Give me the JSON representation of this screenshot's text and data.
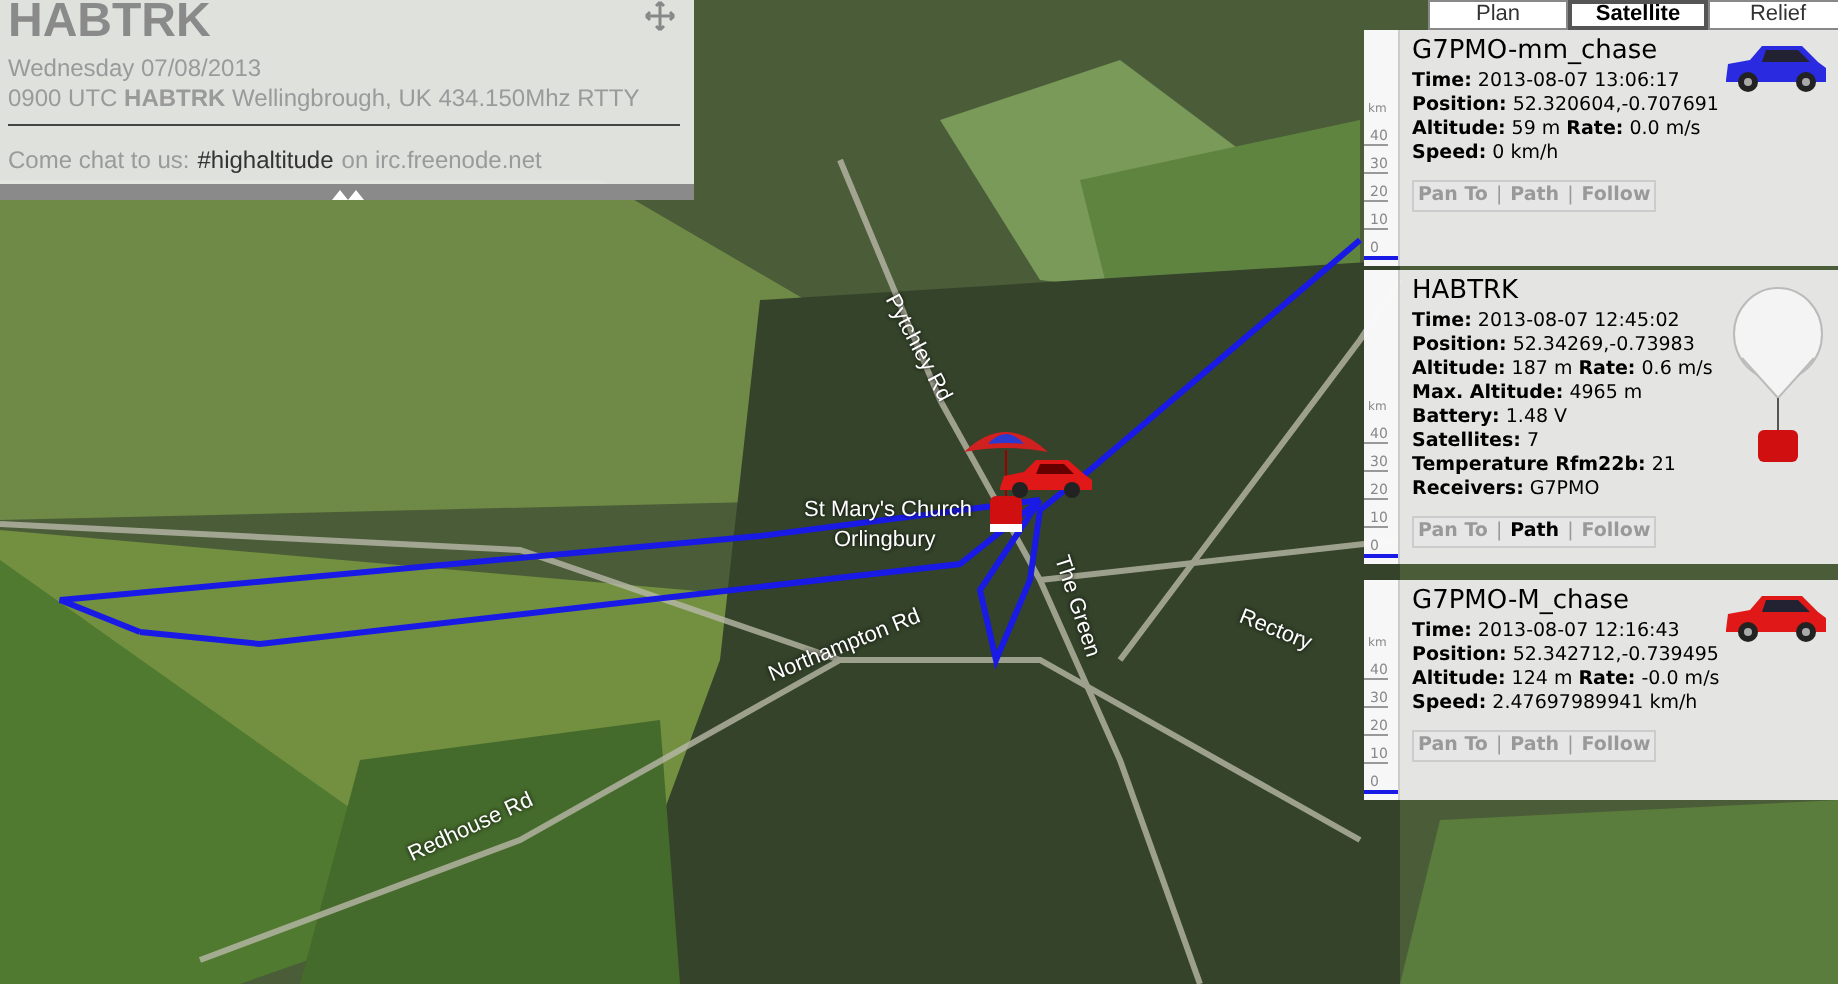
{
  "header": {
    "title": "HABTRK",
    "date": "Wednesday 07/08/2013",
    "launch": "0900 UTC **HABTRK** Wellingbrough, UK 434.150Mhz RTTY",
    "chat_prefix": "Come chat to us:",
    "chat_link": "#highaltitude",
    "chat_suffix": "on irc.freenode.net"
  },
  "map_types": [
    {
      "label": "Plan",
      "selected": false
    },
    {
      "label": "Satellite",
      "selected": true
    },
    {
      "label": "Relief",
      "selected": false
    }
  ],
  "map_labels": [
    "Pytchley Rd",
    "St Mary's Church",
    "Orlingbury",
    "The Green",
    "Northampton Rd",
    "Rectory",
    "Redhouse Rd"
  ],
  "vehicles": [
    {
      "name": "G7PMO-mm_chase",
      "kind": "car",
      "color": "#2a2ae0",
      "separator": "|",
      "lines": [
        "**Time:** 2013-08-07 13:06:17",
        "**Position:** 52.320604,-0.707691",
        "**Altitude:** 59 m **Rate:** 0.0 m/s",
        "**Speed:** 0 km/h"
      ],
      "actions": [
        {
          "label": "Pan To",
          "active": false
        },
        {
          "label": "Path",
          "active": false
        },
        {
          "label": "Follow",
          "active": false
        }
      ],
      "scale": {
        "unit": "km",
        "ticks": [
          "40",
          "30",
          "20",
          "10",
          "0"
        ],
        "level": 0
      }
    },
    {
      "name": "HABTRK",
      "kind": "balloon",
      "color": "#d01010",
      "separator": "|",
      "lines": [
        "**Time:** 2013-08-07 12:45:02",
        "**Position:** 52.34269,-0.73983",
        "**Altitude:** 187 m **Rate:** 0.6 m/s",
        "**Max. Altitude:** 4965 m",
        "**Battery:** 1.48 V",
        "**Satellites:** 7",
        "**Temperature Rfm22b:** 21",
        "**Receivers:** G7PMO"
      ],
      "actions": [
        {
          "label": "Pan To",
          "active": false
        },
        {
          "label": "Path",
          "active": true
        },
        {
          "label": "Follow",
          "active": false
        }
      ],
      "scale": {
        "unit": "km",
        "ticks": [
          "40",
          "30",
          "20",
          "10",
          "0"
        ],
        "level": 0
      }
    },
    {
      "name": "G7PMO-M_chase",
      "kind": "car",
      "color": "#e01818",
      "separator": "|",
      "lines": [
        "**Time:** 2013-08-07 12:16:43",
        "**Position:** 52.342712,-0.739495",
        "**Altitude:** 124 m **Rate:** -0.0 m/s",
        "**Speed:** 2.47697989941 km/h"
      ],
      "actions": [
        {
          "label": "Pan To",
          "active": false
        },
        {
          "label": "Path",
          "active": false
        },
        {
          "label": "Follow",
          "active": false
        }
      ],
      "scale": {
        "unit": "km",
        "ticks": [
          "40",
          "30",
          "20",
          "10",
          "0"
        ],
        "level": 0
      }
    }
  ]
}
